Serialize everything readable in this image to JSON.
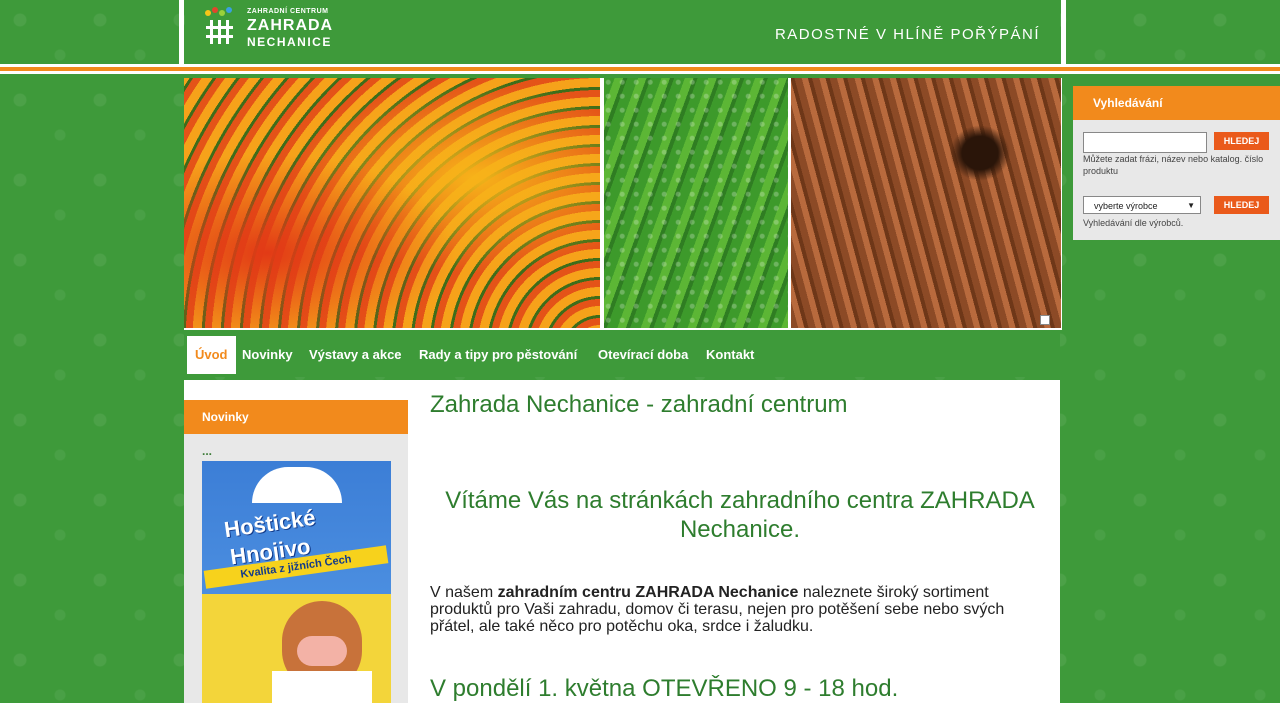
{
  "header": {
    "logo_small": "ZAHRADNÍ CENTRUM",
    "logo_line1": "ZAHRADA",
    "logo_line2": "NECHANICE",
    "slogan": "RADOSTNÉ V HLÍNĚ POŘÝPÁNÍ"
  },
  "nav": {
    "items": [
      {
        "label": "Úvod",
        "active": true
      },
      {
        "label": "Novinky"
      },
      {
        "label": "Výstavy a akce"
      },
      {
        "label": "Rady a tipy pro pěstování"
      },
      {
        "label": "Otevírací doba"
      },
      {
        "label": "Kontakt"
      }
    ]
  },
  "sidebar": {
    "title": "Novinky",
    "more": "...",
    "ad": {
      "brand_line1": "Hoštické",
      "brand_line2": "Hnojivo",
      "tagline": "Kvalita z jižních Čech"
    }
  },
  "content": {
    "heading": "Zahrada Nechanice - zahradní centrum",
    "welcome": "Vítáme Vás na stránkách zahradního centra ZAHRADA Nechanice.",
    "para_pre": "V našem ",
    "para_bold": "zahradním centru ZAHRADA Nechanice",
    "para_post": " naleznete široký sortiment produktů pro Vaši zahradu, domov či terasu, nejen pro potěšení sebe nebo svých přátel, ale také něco pro potěchu oka, srdce i žaludku.",
    "notice": "V pondělí 1. května OTEVŘENO 9 - 18 hod."
  },
  "search": {
    "title": "Vyhledávání",
    "query_value": "",
    "button": "HLEDEJ",
    "hint": "Můžete zadat frázi, název nebo katalog. číslo produktu",
    "select_value": "vyberte výrobce",
    "button2": "HLEDEJ",
    "hint2": "Vyhledávání dle výrobců."
  },
  "colors": {
    "green": "#3e9a3a",
    "orange": "#f28a1c",
    "button_orange": "#ea5a1b",
    "text_green": "#2e7d2e"
  }
}
